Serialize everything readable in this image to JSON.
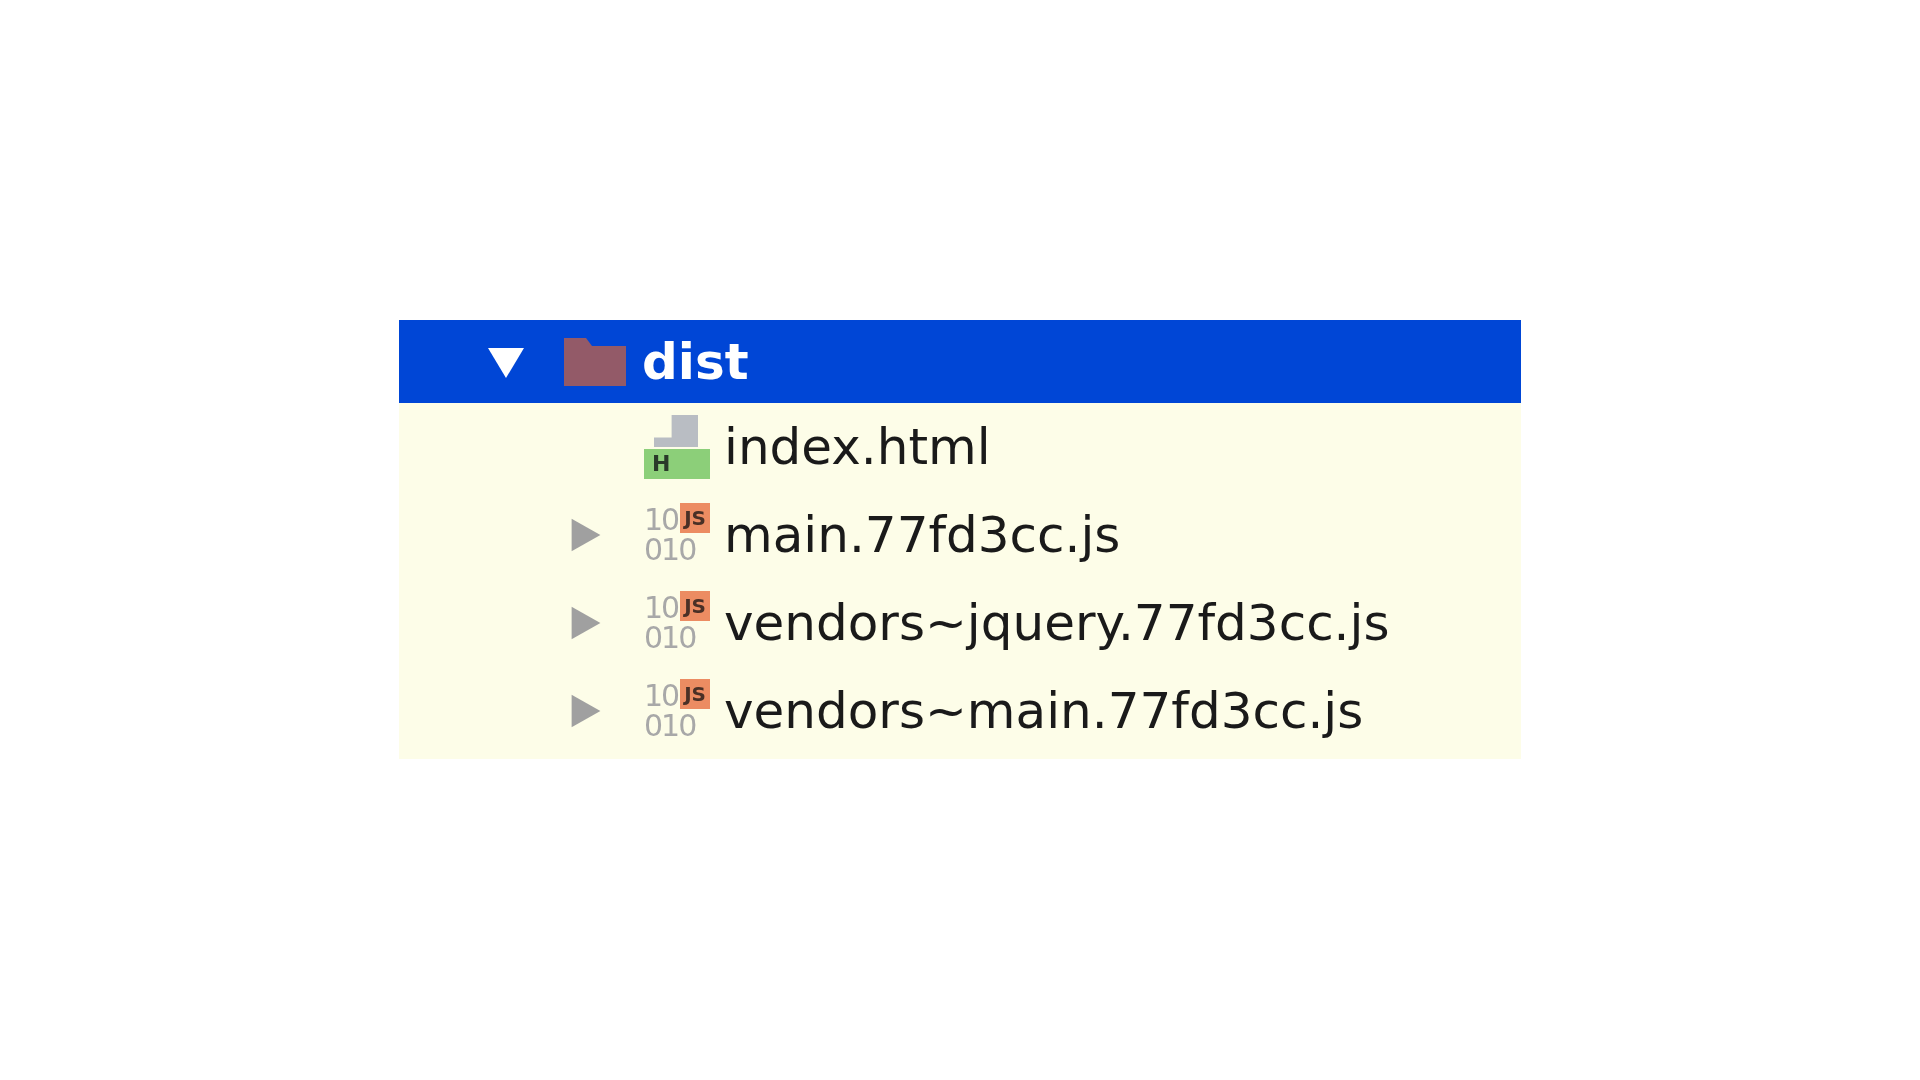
{
  "tree": [
    {
      "kind": "folder",
      "name": "dist",
      "expanded": true,
      "selected": true,
      "children": [
        {
          "kind": "html",
          "name": "index.html",
          "selected": false,
          "badge": "H"
        },
        {
          "kind": "js",
          "name": "main.77fd3cc.js",
          "expanded": false,
          "selected": false,
          "badge": "JS",
          "binary": [
            "10",
            "010"
          ]
        },
        {
          "kind": "js",
          "name": "vendors~jquery.77fd3cc.js",
          "expanded": false,
          "selected": false,
          "badge": "JS",
          "binary": [
            "10",
            "010"
          ]
        },
        {
          "kind": "js",
          "name": "vendors~main.77fd3cc.js",
          "expanded": false,
          "selected": false,
          "badge": "JS",
          "binary": [
            "10",
            "010"
          ]
        }
      ]
    }
  ]
}
